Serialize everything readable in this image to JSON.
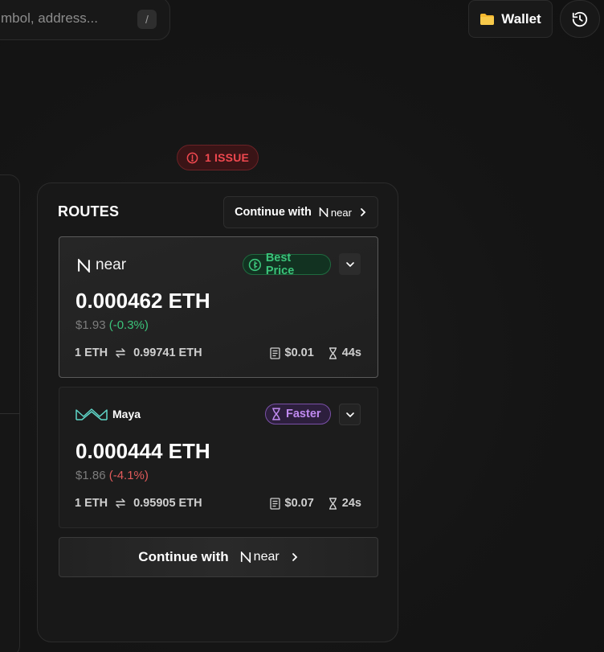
{
  "topbar": {
    "search_placeholder": "mbol, address...",
    "shortcut_key": "/",
    "wallet_label": "Wallet",
    "wallet_icon": "folder-icon",
    "history_icon": "history-icon"
  },
  "issue_badge": {
    "label": "1 ISSUE",
    "color": "#f0484f"
  },
  "routes": {
    "title": "ROUTES",
    "continue_label": "Continue with",
    "continue_provider": "near",
    "cards": [
      {
        "provider": "near",
        "badge": "Best Price",
        "amount": "0.000462 ETH",
        "usd": "$1.93",
        "change": "(-0.3%)",
        "rate_from": "1 ETH",
        "rate_to": "0.99741 ETH",
        "fee": "$0.01",
        "time": "44s",
        "selected": true
      },
      {
        "provider": "Maya",
        "badge": "Faster",
        "amount": "0.000444 ETH",
        "usd": "$1.86",
        "change": "(-4.1%)",
        "rate_from": "1 ETH",
        "rate_to": "0.95905 ETH",
        "fee": "$0.07",
        "time": "24s",
        "selected": false
      }
    ],
    "bottom_continue_label": "Continue with",
    "bottom_continue_provider": "near"
  },
  "colors": {
    "best_price": "#3bc37a",
    "faster": "#c08af0",
    "negative_change": "#e25b5b",
    "maya_brand": "#5fd6c8",
    "wallet_folder": "#f5b82e"
  }
}
